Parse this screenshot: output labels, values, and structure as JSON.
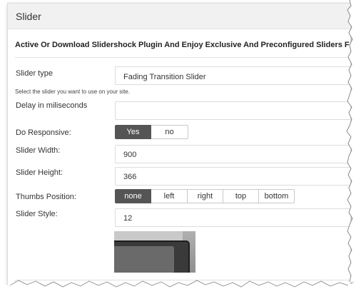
{
  "panel": {
    "title": "Slider"
  },
  "notice": "Active Or Download Slidershock Plugin And Enjoy Exclusive And Preconfigured Sliders For",
  "form": {
    "slider_type": {
      "label": "Slider type",
      "value": "Fading Transition Slider",
      "hint": "Select the slider you want to use on your site."
    },
    "delay": {
      "label": "Delay in miliseconds",
      "value": ""
    },
    "responsive": {
      "label": "Do Responsive:",
      "options": [
        "Yes",
        "no"
      ],
      "selected": "Yes"
    },
    "width": {
      "label": "Slider Width:",
      "value": "900"
    },
    "height": {
      "label": "Slider Height:",
      "value": "366"
    },
    "thumbs": {
      "label": "Thumbs Position:",
      "options": [
        "none",
        "left",
        "right",
        "top",
        "bottom"
      ],
      "selected": "none"
    },
    "style": {
      "label": "Slider Style:",
      "value": "12"
    }
  },
  "colors": {
    "segment_active": "#555555",
    "panel_header": "#f1f1f1",
    "border": "#dcdcdc"
  }
}
